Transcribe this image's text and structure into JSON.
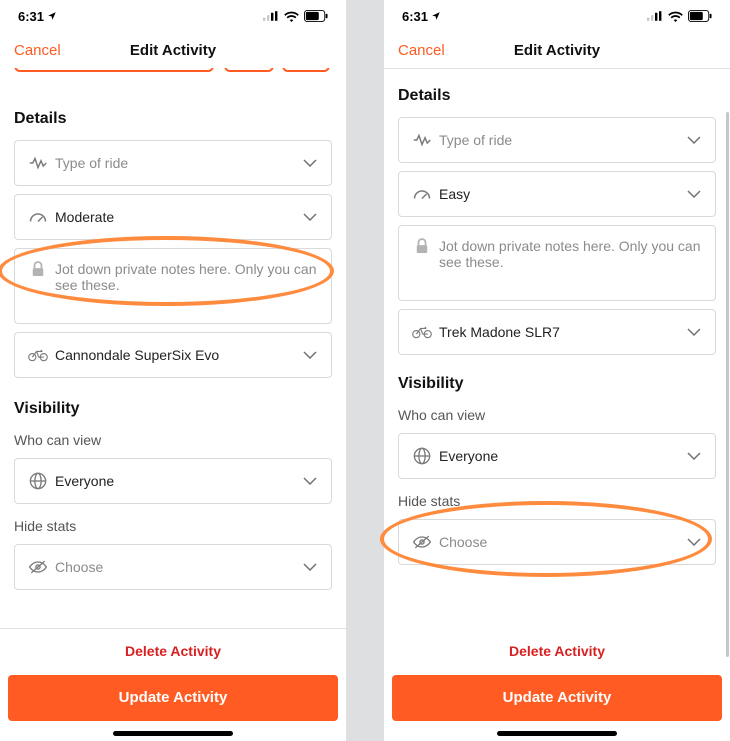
{
  "status": {
    "time": "6:31"
  },
  "nav": {
    "cancel": "Cancel",
    "title": "Edit Activity"
  },
  "details_title": "Details",
  "visibility_title": "Visibility",
  "who_can_view_label": "Who can view",
  "hide_stats_label": "Hide stats",
  "notes_placeholder": "Jot down private notes here. Only you can see these.",
  "delete_label": "Delete Activity",
  "update_label": "Update Activity",
  "left": {
    "ride_type": "Type of ride",
    "effort": "Moderate",
    "gear": "Cannondale SuperSix Evo",
    "visibility": "Everyone",
    "hide_stats": "Choose"
  },
  "right": {
    "ride_type": "Type of ride",
    "effort": "Easy",
    "gear": "Trek Madone SLR7",
    "visibility": "Everyone",
    "hide_stats": "Choose"
  }
}
